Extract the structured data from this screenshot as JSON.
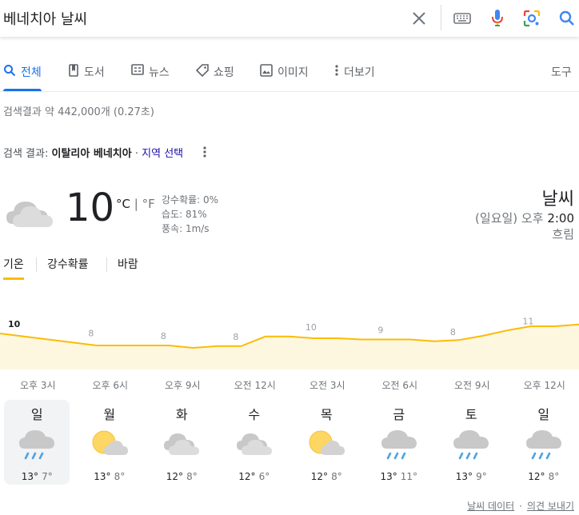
{
  "search": {
    "query": "베네치아 날씨"
  },
  "tabs": [
    {
      "label": "전체",
      "icon": "search-icon"
    },
    {
      "label": "도서",
      "icon": "book-icon"
    },
    {
      "label": "뉴스",
      "icon": "news-icon"
    },
    {
      "label": "쇼핑",
      "icon": "tag-icon"
    },
    {
      "label": "이미지",
      "icon": "image-icon"
    },
    {
      "label": "더보기",
      "icon": "more-vert-icon"
    }
  ],
  "tools_label": "도구",
  "result_stats": "검색결과 약 442,000개 (0.27초)",
  "results_for": {
    "prefix": "검색 결과:",
    "place": "이탈리아 베네치아",
    "sep": "·",
    "choose": "지역 선택"
  },
  "weather": {
    "temp": "10",
    "unit_c": "°C",
    "unit_sep": "|",
    "unit_f": "°F",
    "precip": "강수확률: 0%",
    "humidity": "습도: 81%",
    "wind": "풍속: 1m/s",
    "title": "날씨",
    "time_prefix": "(일요일) 오후",
    "time": "2:00",
    "condition": "흐림"
  },
  "sub_tabs": [
    "기온",
    "강수확률",
    "바람"
  ],
  "chart_data": {
    "type": "area",
    "labels": [
      {
        "x": 0,
        "value": 10
      },
      {
        "x": 1,
        "value": 8
      },
      {
        "x": 2,
        "value": 8
      },
      {
        "x": 3,
        "value": 8
      },
      {
        "x": 4,
        "value": 10
      },
      {
        "x": 5,
        "value": 9
      },
      {
        "x": 6,
        "value": 8
      },
      {
        "x": 7,
        "value": 11
      }
    ],
    "x_labels": [
      "오후 3시",
      "오후 6시",
      "오후 9시",
      "오전 12시",
      "오전 3시",
      "오전 6시",
      "오전 9시",
      "오후 12시"
    ],
    "series": [
      {
        "values": [
          10,
          9.5,
          9,
          8.5,
          8,
          8,
          8,
          8,
          7.6,
          7.9,
          7.9,
          9.5,
          9.5,
          9.2,
          9.2,
          9,
          9,
          9,
          8.7,
          8.9,
          9.6,
          10.5,
          11.2,
          11.2,
          11.5
        ]
      }
    ],
    "color": "#fbbc04",
    "fill": "#fef7e0"
  },
  "forecast": [
    {
      "day": "일",
      "hi": "13°",
      "lo": "7°",
      "icon": "rain-icon"
    },
    {
      "day": "월",
      "hi": "13°",
      "lo": "8°",
      "icon": "partly-cloudy-icon"
    },
    {
      "day": "화",
      "hi": "12°",
      "lo": "8°",
      "icon": "cloudy-icon"
    },
    {
      "day": "수",
      "hi": "12°",
      "lo": "6°",
      "icon": "cloudy-icon"
    },
    {
      "day": "목",
      "hi": "12°",
      "lo": "8°",
      "icon": "partly-cloudy-icon"
    },
    {
      "day": "금",
      "hi": "13°",
      "lo": "11°",
      "icon": "rain-icon"
    },
    {
      "day": "토",
      "hi": "13°",
      "lo": "9°",
      "icon": "rain-icon"
    },
    {
      "day": "일",
      "hi": "12°",
      "lo": "8°",
      "icon": "rain-icon"
    }
  ],
  "footer": {
    "data": "날씨 데이터",
    "dot": "·",
    "feedback": "의견 보내기"
  }
}
